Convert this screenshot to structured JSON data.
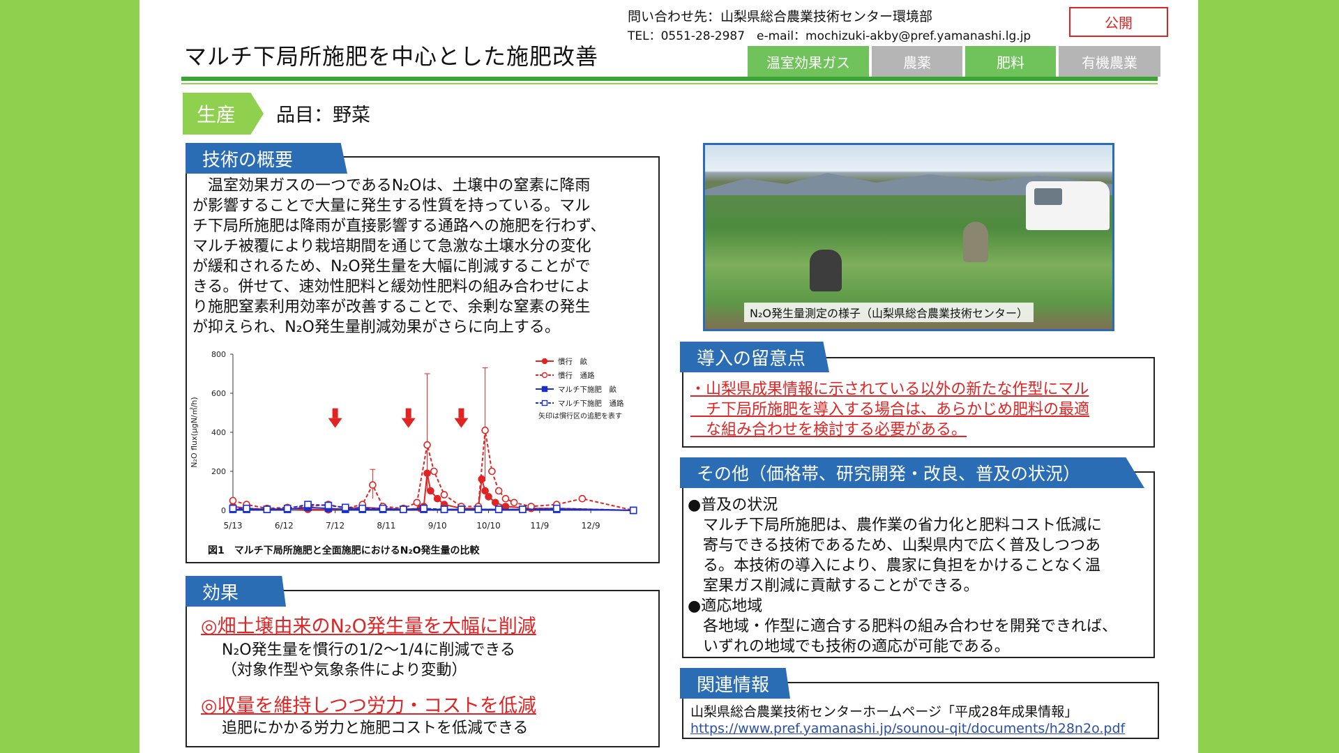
{
  "header": {
    "contact_line1": "問い合わせ先：山梨県総合農業技術センター環境部",
    "contact_line2": "TEL：0551-28-2987　e-mail：mochizuki-akby@pref.yamanashi.lg.jp",
    "public_label": "公開",
    "title": "マルチ下局所施肥を中心とした施肥改善",
    "categories": [
      {
        "label": "温室効果ガス",
        "active": true
      },
      {
        "label": "農薬",
        "active": false
      },
      {
        "label": "肥料",
        "active": true
      },
      {
        "label": "有機農業",
        "active": false
      }
    ]
  },
  "sector": {
    "label": "生産",
    "item": "品目：野菜"
  },
  "overview": {
    "label": "技術の概要",
    "lines": [
      "　温室効果ガスの一つであるN₂Oは、土壌中の窒素に降雨",
      "が影響することで大量に発生する性質を持っている。マル",
      "チ下局所施肥は降雨が直接影響する通路への施肥を行わず、",
      "マルチ被覆により栽培期間を通じて急激な土壌水分の変化",
      "が緩和されるため、N₂O発生量を大幅に削減することがで",
      "きる。併せて、速効性肥料と緩効性肥料の組み合わせによ",
      "り施肥窒素利用効率が改善することで、余剰な窒素の発生",
      "が抑えられ、N₂O発生量削減効果がさらに向上する。"
    ],
    "figure_caption": "図1　マルチ下局所施肥と全面施肥におけるN₂O発生量の比較"
  },
  "chart_data": {
    "type": "line",
    "title": "",
    "xlabel": "",
    "ylabel": "N₂O flux(μgN/㎡/h)",
    "ylim": [
      0,
      800
    ],
    "yticks": [
      0,
      200,
      400,
      600,
      800
    ],
    "xticks": [
      "5/13",
      "6/12",
      "7/12",
      "8/11",
      "9/10",
      "10/10",
      "11/9",
      "12/9"
    ],
    "xrange_days": [
      0,
      230
    ],
    "grid": false,
    "legend_position": "top-right",
    "legend_note": "矢印は慣行区の追肥を表す",
    "arrows_x": [
      60,
      103,
      134
    ],
    "series": [
      {
        "name": "慣行　畝",
        "color": "#e02424",
        "dashed": false,
        "marker": "filled-circle",
        "x": [
          0,
          8,
          20,
          32,
          44,
          56,
          66,
          76,
          88,
          100,
          110,
          112,
          114,
          116,
          120,
          124,
          134,
          144,
          146,
          148,
          150,
          154,
          160,
          175,
          190,
          235
        ],
        "y": [
          20,
          10,
          5,
          8,
          5,
          3,
          8,
          15,
          10,
          5,
          10,
          20,
          190,
          100,
          60,
          30,
          10,
          10,
          160,
          100,
          70,
          40,
          20,
          10,
          10,
          0
        ]
      },
      {
        "name": "慣行　通路",
        "color": "#e02424",
        "dashed": true,
        "marker": "open-circle",
        "x": [
          0,
          8,
          20,
          32,
          44,
          56,
          66,
          76,
          82,
          88,
          100,
          108,
          114,
          118,
          124,
          134,
          144,
          148,
          152,
          156,
          160,
          165,
          175,
          190,
          205,
          235
        ],
        "y": [
          50,
          30,
          10,
          15,
          20,
          30,
          10,
          30,
          130,
          20,
          10,
          40,
          335,
          200,
          80,
          20,
          20,
          410,
          200,
          100,
          60,
          40,
          20,
          30,
          60,
          0
        ]
      },
      {
        "name": "マルチ下施肥　畝",
        "color": "#1b2fd0",
        "dashed": false,
        "marker": "filled-square",
        "x": [
          0,
          8,
          20,
          32,
          44,
          56,
          66,
          76,
          88,
          100,
          112,
          124,
          134,
          144,
          156,
          170,
          190,
          235
        ],
        "y": [
          5,
          5,
          5,
          5,
          15,
          10,
          5,
          5,
          5,
          5,
          5,
          5,
          5,
          5,
          5,
          5,
          5,
          0
        ]
      },
      {
        "name": "マルチ下施肥　通路",
        "color": "#1b2fd0",
        "dashed": true,
        "marker": "open-square",
        "x": [
          0,
          8,
          20,
          32,
          44,
          56,
          66,
          76,
          88,
          100,
          112,
          124,
          134,
          144,
          156,
          170,
          190,
          235
        ],
        "y": [
          10,
          10,
          5,
          10,
          30,
          25,
          15,
          10,
          10,
          5,
          10,
          5,
          5,
          5,
          5,
          5,
          10,
          0
        ]
      }
    ],
    "error_bars": [
      {
        "x": 82,
        "low": 60,
        "high": 210
      },
      {
        "x": 114,
        "low": 100,
        "high": 700
      },
      {
        "x": 148,
        "low": 150,
        "high": 730
      }
    ]
  },
  "effects": {
    "label": "効果",
    "headline1": "◎畑土壌由来のN₂O発生量を大幅に削減",
    "detail1a": "N₂O発生量を慣行の1/2～1/4に削減できる",
    "detail1b": "（対象作型や気象条件により変動）",
    "headline2": "◎収量を維持しつつ労力・コストを低減",
    "detail2": "追肥にかかる労力と施肥コストを低減できる"
  },
  "photo": {
    "caption": "N₂O発生量測定の様子（山梨県総合農業技術センター）"
  },
  "caution": {
    "label": "導入の留意点",
    "lines": [
      "・山梨県成果情報に示されている以外の新たな作型にマル",
      "　チ下局所施肥を導入する場合は、あらかじめ肥料の最適",
      "　な組み合わせを検討する必要がある。"
    ]
  },
  "other": {
    "label": "その他（価格帯、研究開発・改良、普及の状況）",
    "spread_heading": "●普及の状況",
    "spread_lines": [
      "マルチ下局所施肥は、農作業の省力化と肥料コスト低減に",
      "寄与できる技術であるため、山梨県内で広く普及しつつあ",
      "る。本技術の導入により、農家に負担をかけることなく温",
      "室果ガス削減に貢献することができる。"
    ],
    "region_heading": "●適応地域",
    "region_lines": [
      "各地域・作型に適合する肥料の組み合わせを開発できれば、",
      "いずれの地域でも技術の適応が可能である。"
    ]
  },
  "related": {
    "label": "関連情報",
    "text": "山梨県総合農業技術センターホームページ「平成28年成果情報」",
    "url": "https://www.pref.yamanashi.jp/sounou-qit/documents/h28n2o.pdf"
  }
}
